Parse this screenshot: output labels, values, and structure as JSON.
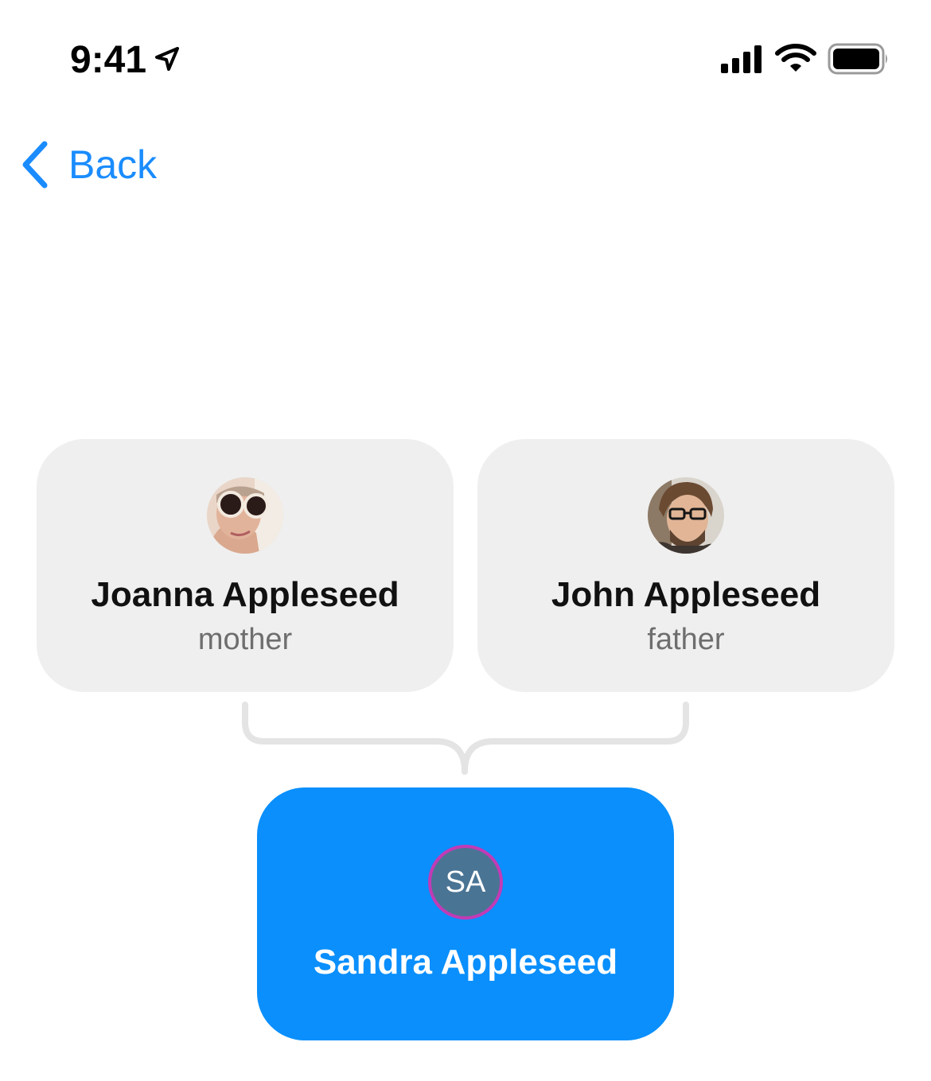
{
  "status_bar": {
    "time": "9:41",
    "icons": [
      "location-arrow-icon",
      "cellular-signal-icon",
      "wifi-icon",
      "battery-icon"
    ]
  },
  "nav": {
    "back_label": "Back",
    "back_icon": "chevron-left-icon"
  },
  "parents": [
    {
      "name": "Joanna Appleseed",
      "relation": "mother",
      "avatar": "photo"
    },
    {
      "name": "John Appleseed",
      "relation": "father",
      "avatar": "photo"
    }
  ],
  "child": {
    "name": "Sandra Appleseed",
    "initials": "SA"
  },
  "colors": {
    "accent": "#1a8cff",
    "child_card": "#0a8ffc",
    "parent_card": "#efefef",
    "initials_bg": "#4a7494",
    "initials_ring": "#c23bb6",
    "connector": "#e4e4e4"
  }
}
